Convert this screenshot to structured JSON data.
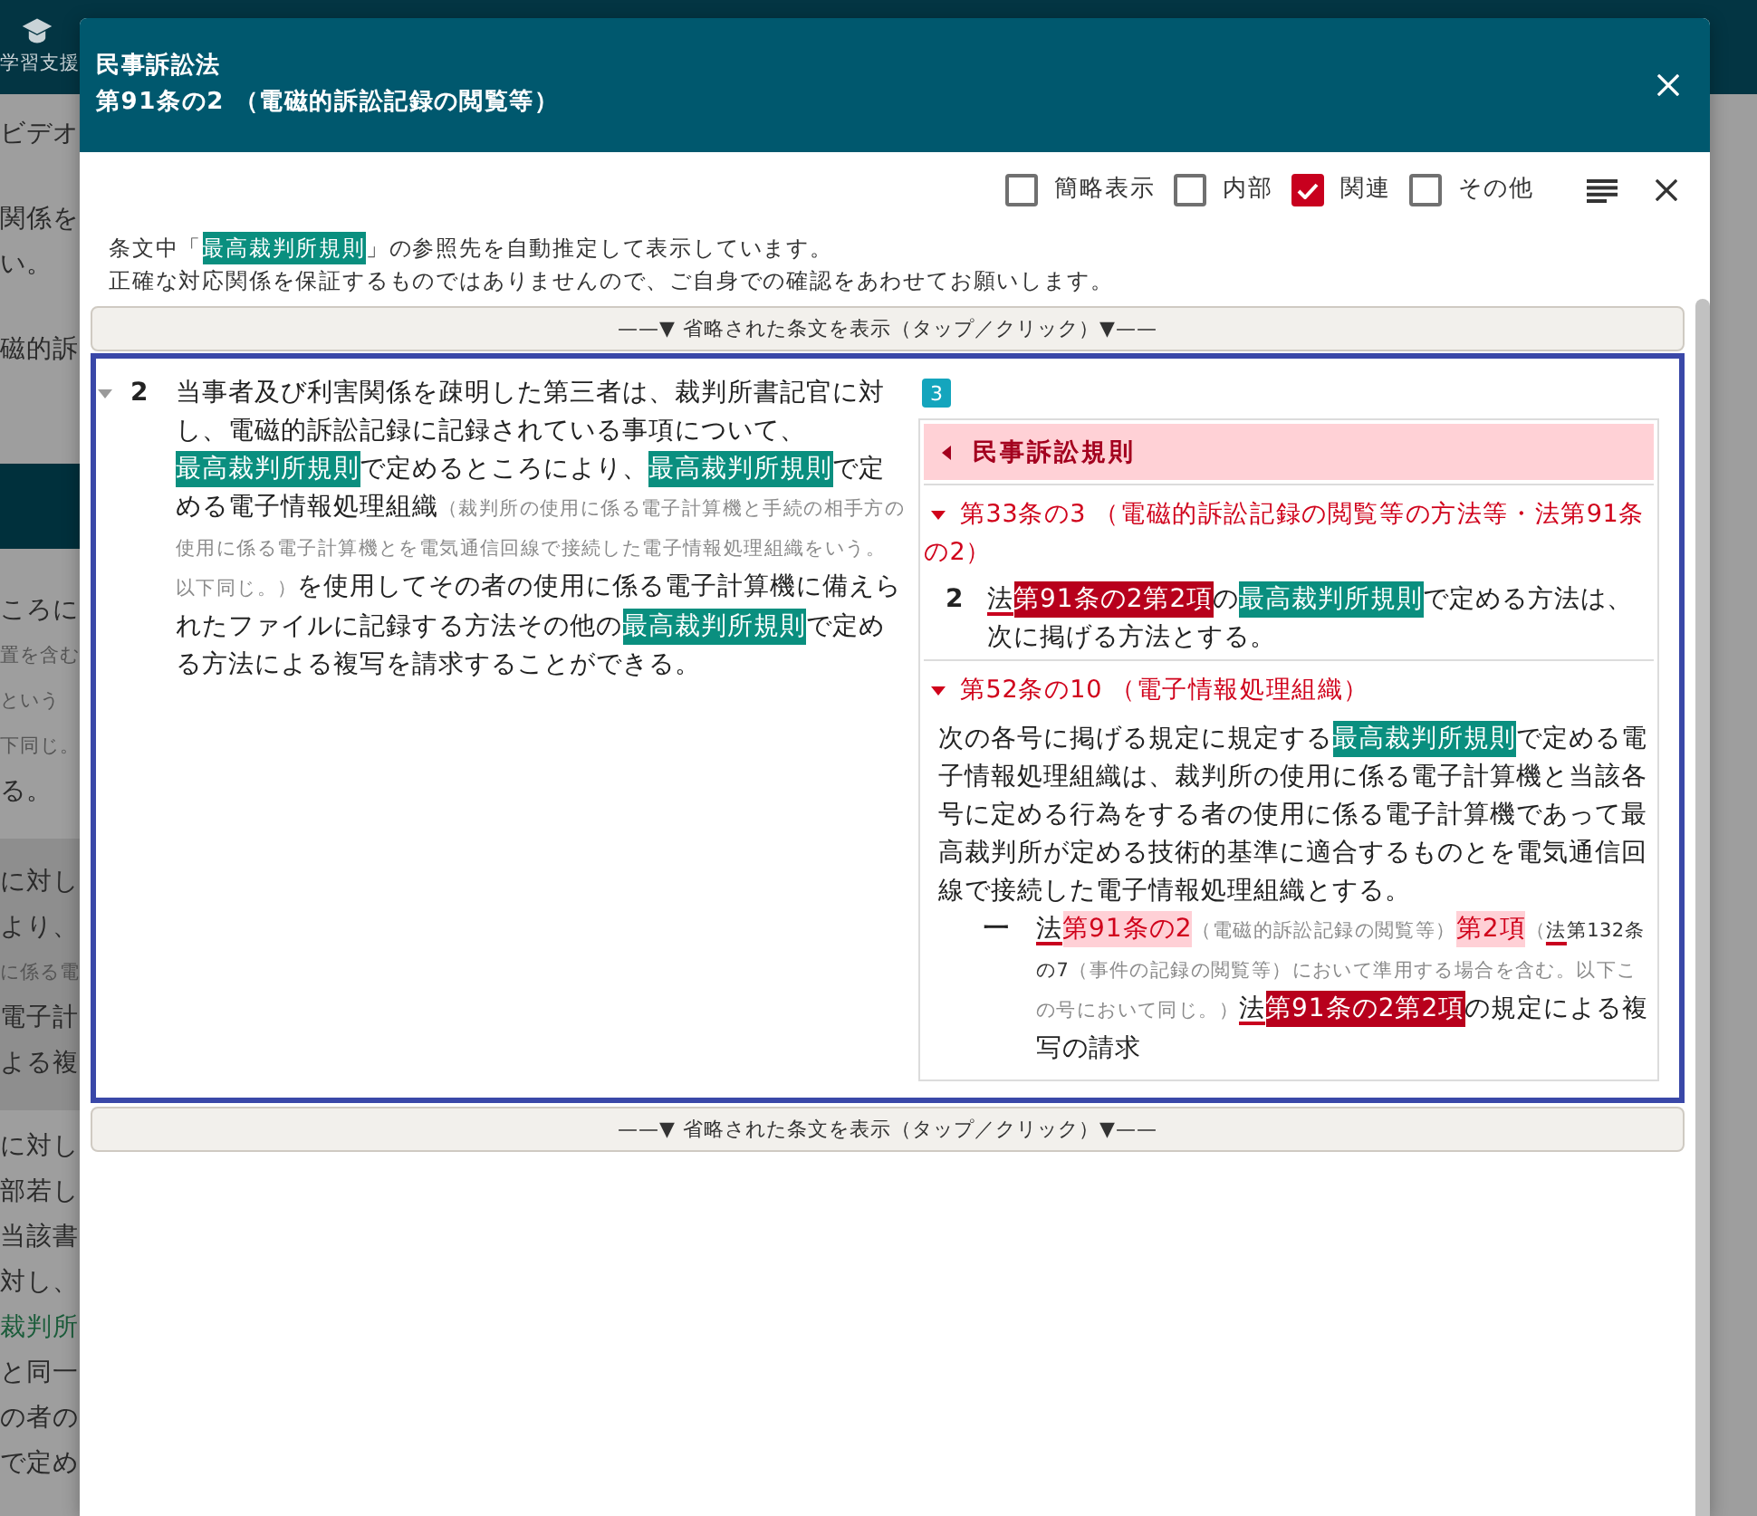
{
  "background_page": {
    "app_label": "学習支援",
    "blocks": [
      {
        "kind": "plain",
        "lines": [
          {
            "kind": "text",
            "text": "ビデオ"
          }
        ]
      },
      {
        "kind": "plain",
        "lines": [
          {
            "kind": "text",
            "text": "関係を"
          },
          {
            "kind": "text",
            "text": "い。"
          }
        ]
      },
      {
        "kind": "plain",
        "lines": [
          {
            "kind": "text",
            "text": "磁的訴"
          }
        ]
      },
      {
        "kind": "banner"
      },
      {
        "kind": "plain",
        "lines": [
          {
            "kind": "text",
            "text": "ころに"
          },
          {
            "kind": "note",
            "text": "置を含む"
          },
          {
            "kind": "note",
            "text": "という"
          },
          {
            "kind": "note",
            "text": "下同じ。"
          },
          {
            "kind": "text",
            "text": "る。"
          }
        ]
      },
      {
        "kind": "shaded",
        "lines": [
          {
            "kind": "text",
            "text": "に対し"
          },
          {
            "kind": "text",
            "text": "より、"
          },
          {
            "kind": "note",
            "text": "に係る電"
          },
          {
            "kind": "text",
            "text": "電子計"
          },
          {
            "kind": "text",
            "text": "よる複"
          }
        ]
      },
      {
        "kind": "plain",
        "lines": [
          {
            "kind": "text",
            "text": "に対し"
          },
          {
            "kind": "text",
            "text": "部若し"
          },
          {
            "kind": "text",
            "text": "当該書"
          },
          {
            "kind": "text",
            "text": "対し、"
          },
          {
            "kind": "term",
            "text": "裁判所"
          },
          {
            "kind": "text",
            "text": "と同一"
          },
          {
            "kind": "text",
            "text": "の者の"
          },
          {
            "kind": "text",
            "text": "で定め"
          }
        ]
      }
    ]
  },
  "dialog": {
    "title": "民事訴訟法",
    "subtitle": "第91条の2 （電磁的訴訟記録の閲覧等）",
    "filters": [
      {
        "label": "簡略表示",
        "checked": false
      },
      {
        "label": "内部",
        "checked": false
      },
      {
        "label": "関連",
        "checked": true
      },
      {
        "label": "その他",
        "checked": false
      }
    ],
    "notice": [
      {
        "segments": [
          {
            "kind": "text",
            "text": "条文中「"
          },
          {
            "kind": "term_sample",
            "text": "最高裁判所規則"
          },
          {
            "kind": "text",
            "text": "」の参照先を自動推定して表示しています。"
          }
        ]
      },
      {
        "segments": [
          {
            "kind": "text",
            "text": "正確な対応関係を保証するものではありませんので、ご自身での確認をあわせてお願いします。"
          }
        ]
      }
    ],
    "expand_above": "——▼ 省略された条文を表示（タップ／クリック）▼——",
    "article": {
      "expanded": true,
      "number": "2",
      "segments": [
        {
          "kind": "text",
          "text": "当事者及び利害関係を疎明した第三者は、裁判所書記官に対し、電磁的訴訟記録に記録されている事項について、"
        },
        {
          "kind": "term",
          "text": "最高裁判所規則"
        },
        {
          "kind": "text",
          "text": "で定めるところにより、"
        },
        {
          "kind": "term",
          "text": "最高裁判所規則"
        },
        {
          "kind": "text",
          "text": "で定める電子情報処理組織"
        },
        {
          "kind": "note",
          "text": "（裁判所の使用に係る電子計算機と手続の相手方の使用に係る電子計算機とを電気通信回線で接続した電子情報処理組織をいう。以下同じ。）"
        },
        {
          "kind": "text",
          "text": "を使用してその者の使用に係る電子計算機に備えられたファイルに記録する方法その他の"
        },
        {
          "kind": "term",
          "text": "最高裁判所規則"
        },
        {
          "kind": "text",
          "text": "で定める方法による複写を請求することができる。"
        }
      ]
    },
    "related": {
      "count": "3",
      "group": {
        "title": "民事訴訟規則",
        "sections": [
          {
            "title": "第33条の3 （電磁的訴訟記録の閲覧等の方法等・法第91条の2）",
            "expanded": true,
            "paragraphs": [
              {
                "number": "2",
                "segments": [
                  {
                    "kind": "law",
                    "text": "法"
                  },
                  {
                    "kind": "article_current",
                    "text": "第91条の2第2項"
                  },
                  {
                    "kind": "text",
                    "text": "の"
                  },
                  {
                    "kind": "term",
                    "text": "最高裁判所規則"
                  },
                  {
                    "kind": "text",
                    "text": "で定める方法は、次に掲げる方法とする。"
                  }
                ]
              }
            ]
          },
          {
            "title": "第52条の10 （電子情報処理組織）",
            "expanded": true,
            "paragraphs": [
              {
                "segments": [
                  {
                    "kind": "text",
                    "text": "次の各号に掲げる規定に規定する"
                  },
                  {
                    "kind": "term",
                    "text": "最高裁判所規則"
                  },
                  {
                    "kind": "text",
                    "text": "で定める電子情報処理組織は、裁判所の使用に係る電子計算機と当該各号に定める行為をする者の使用に係る電子計算機であって最高裁判所が定める技術的基準に適合するものとを電気通信回線で接続した電子情報処理組織とする。"
                  }
                ]
              }
            ],
            "items": [
              {
                "number": "一",
                "segments": [
                  {
                    "kind": "law",
                    "text": "法"
                  },
                  {
                    "kind": "article",
                    "text": "第91条の2"
                  },
                  {
                    "kind": "note",
                    "text": "（電磁的訴訟記録の閲覧等）"
                  },
                  {
                    "kind": "article",
                    "text": "第2項"
                  },
                  {
                    "kind": "note",
                    "text": "（"
                  },
                  {
                    "kind": "note_law",
                    "text": "法"
                  },
                  {
                    "kind": "note_article",
                    "text": "第132条の7"
                  },
                  {
                    "kind": "note",
                    "text": "（事件の記録の閲覧等）において準用する場合を含む。以下この号において同じ。）"
                  },
                  {
                    "kind": "law",
                    "text": "法"
                  },
                  {
                    "kind": "article_current",
                    "text": "第91条の2第2項"
                  },
                  {
                    "kind": "text",
                    "text": "の規定による複写の請求"
                  }
                ]
              }
            ]
          }
        ]
      }
    },
    "expand_below": "——▼ 省略された条文を表示（タップ／クリック）▼——"
  }
}
